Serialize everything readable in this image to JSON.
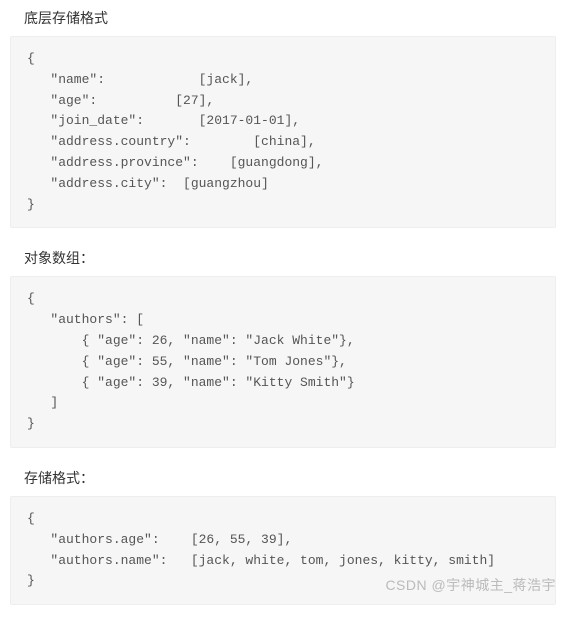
{
  "sections": {
    "title1": "底层存储格式",
    "code1": "{\n   \"name\":            [jack],\n   \"age\":          [27],\n   \"join_date\":       [2017-01-01],\n   \"address.country\":        [china],\n   \"address.province\":    [guangdong],\n   \"address.city\":  [guangzhou]\n}",
    "title2": "对象数组：",
    "code2": "{\n   \"authors\": [\n       { \"age\": 26, \"name\": \"Jack White\"},\n       { \"age\": 55, \"name\": \"Tom Jones\"},\n       { \"age\": 39, \"name\": \"Kitty Smith\"}\n   ]\n}",
    "title3": "存储格式：",
    "code3": "{\n   \"authors.age\":    [26, 55, 39],\n   \"authors.name\":   [jack, white, tom, jones, kitty, smith]\n}"
  },
  "watermark": "CSDN @宇神城主_蒋浩宇"
}
